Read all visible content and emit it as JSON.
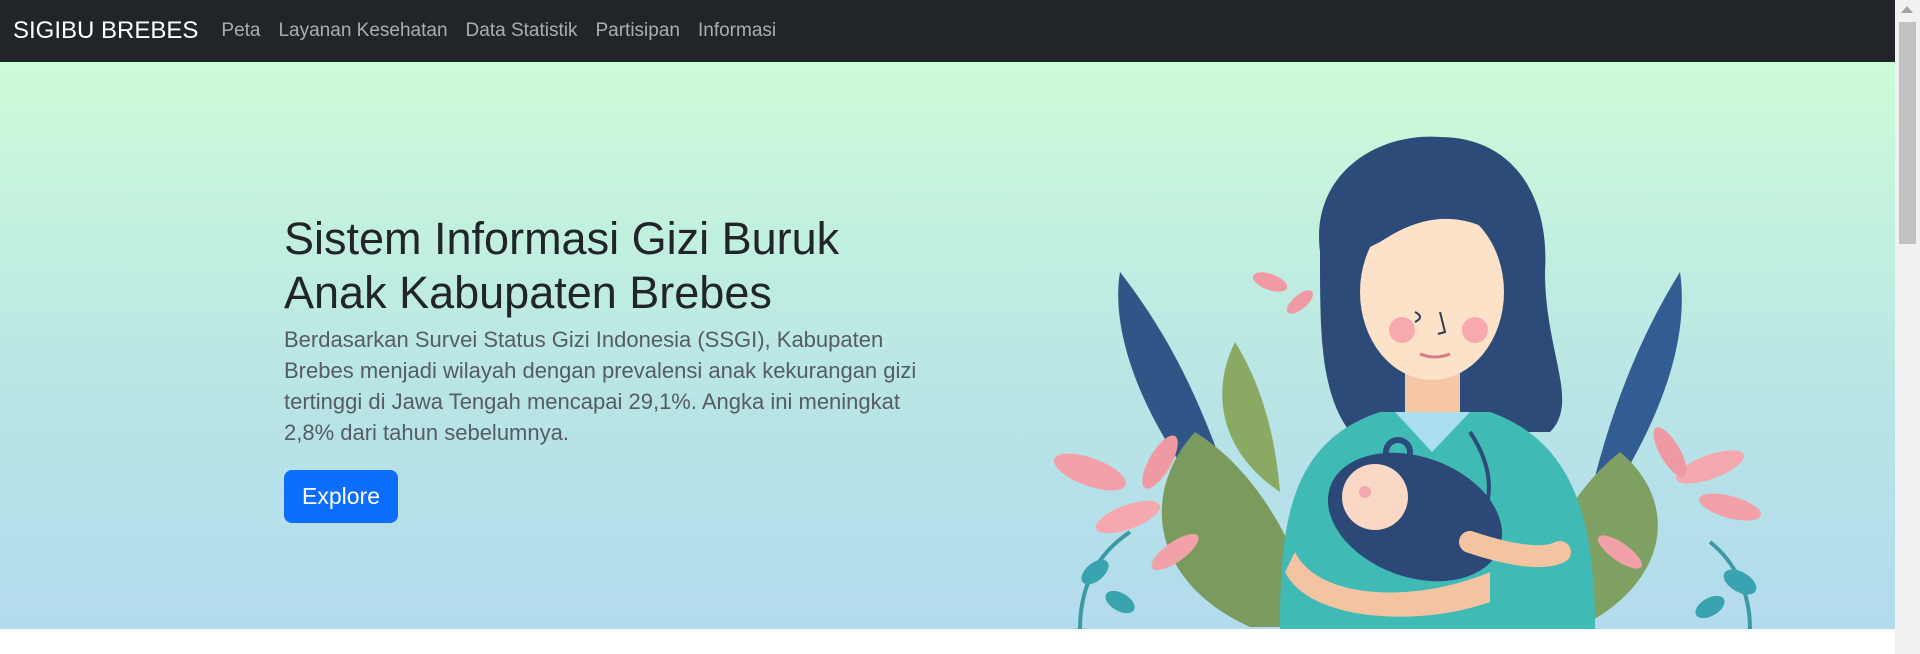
{
  "navbar": {
    "brand": "SIGIBU BREBES",
    "links": [
      "Peta",
      "Layanan Kesehatan",
      "Data Statistik",
      "Partisipan",
      "Informasi"
    ]
  },
  "hero": {
    "title": "Sistem Informasi Gizi Buruk Anak Kabupaten Brebes",
    "lead": "Berdasarkan Survei Status Gizi Indonesia (SSGI), Kabupaten Brebes menjadi wilayah dengan prevalensi anak kekurangan gizi tertinggi di Jawa Tengah mencapai 29,1%. Angka ini meningkat 2,8% dari tahun sebelumnya.",
    "button_label": "Explore",
    "illustration": "nurse-holding-baby-illustration"
  },
  "colors": {
    "navbar_bg": "#212529",
    "button": "#0d6efd",
    "hero_top": "#cdfcd9",
    "hero_bottom": "#b3dbee"
  }
}
